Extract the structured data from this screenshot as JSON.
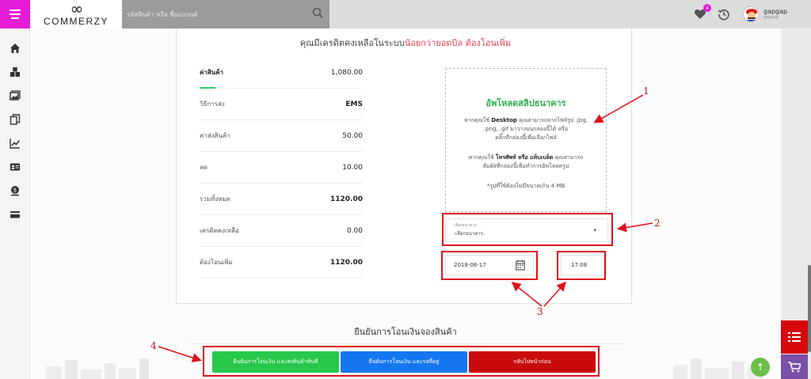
{
  "header": {
    "logo_mark": "∞",
    "logo_text": "COMMERZY",
    "search_placeholder": "รหัสสินค้า หรือ ชื่อแบรนด์",
    "favorites_count": "4",
    "username": "gapgap",
    "user_sub": "gapgap"
  },
  "notice": {
    "text": "คุณมีเครดิตคงเหลือในระบบ",
    "highlight": "น้อยกว่ายอดบิล ต้องโอนเพิ่ม"
  },
  "summary": [
    {
      "label": "ค่าสินค้า",
      "value": "1,080.00"
    },
    {
      "label": "วิธีการส่ง",
      "value": "EMS"
    },
    {
      "label": "ค่าส่งสินค้า",
      "value": "50.00"
    },
    {
      "label": "ลด",
      "value": "10.00"
    },
    {
      "label": "รวมทั้งหมด",
      "value": "1120.00"
    },
    {
      "label": "เครดิตคงเหลือ",
      "value": "0.00"
    },
    {
      "label": "ต้องโอนเพิ่ม",
      "value": "1120.00"
    }
  ],
  "upload": {
    "title": "อัพโหลดสลิปธนาคาร",
    "desktop_line1_pre": "หากคุณใช้ ",
    "desktop_bold": "Desktop",
    "desktop_line1_post": " คุณสามารถลากไฟล์รูป .jpg,",
    "desktop_line2": ".png, .gif มาวางบนกล่องนี้ได้ หรือ",
    "desktop_line3": "คลิ๊กที่กล่องนี้เพื่อเลือกไฟล์",
    "mobile_line1_pre": "หากคุณใช้ ",
    "mobile_bold": "โทรศัพท์ หรือ แท็บเบล็ต",
    "mobile_line1_post": " คุณสามารถ",
    "mobile_line2": "สัมผัสที่กล่องนี้เพื่อทำการอัพโหลดรูป",
    "note": "*รูปที่ใช้ต้องไม่มีขนาดเกิน 4 MB"
  },
  "bank": {
    "label": "เลือกธนาคาร",
    "value": "-เลือกธนาคาร-"
  },
  "transfer_date": "2018-08-17",
  "transfer_time": "17:08",
  "confirm_title": "ยืนยันการโอนเงินจองสินค้า",
  "buttons": {
    "confirm_ship": "ยืนยันการโอนเงิน และส่งสินค้าทันที",
    "confirm_wait": "ยืนยันการโอนเงิน และรอที่อยู่",
    "back": "กลับไปหน้าก่อน"
  },
  "annotations": [
    "1",
    "2",
    "3",
    "4"
  ],
  "colors": {
    "accent": "#e51cd8",
    "highlight": "#e8424f",
    "green": "#27c74c",
    "blue": "#1477f0",
    "red": "#c80c0c"
  }
}
